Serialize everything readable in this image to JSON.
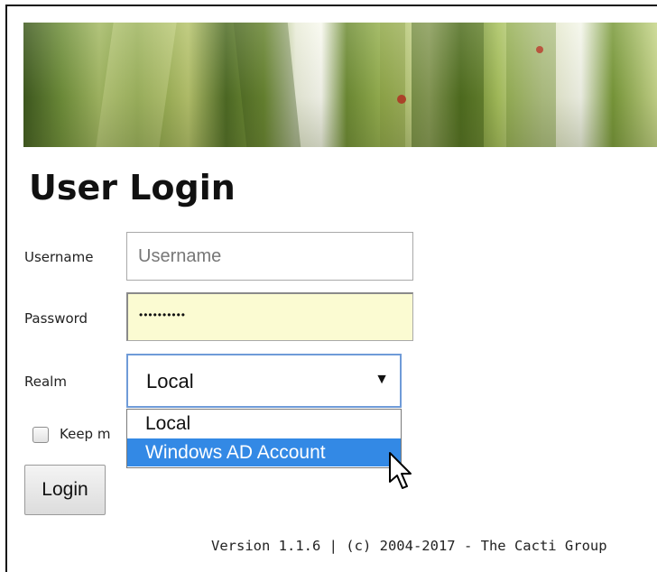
{
  "header": {
    "title": "User Login"
  },
  "form": {
    "username_label": "Username",
    "username_placeholder": "Username",
    "password_label": "Password",
    "password_value": "••••••••••",
    "realm_label": "Realm",
    "realm_selected": "Local",
    "realm_options": [
      "Local",
      "Windows AD Account"
    ],
    "realm_highlighted": "Windows AD Account",
    "keep_label": "Keep m",
    "keep_checked": false,
    "login_label": "Login"
  },
  "footer": {
    "version": "Version 1.1.6 | (c) 2004-2017 - The Cacti Group"
  },
  "colors": {
    "highlight": "#3389e5",
    "password_bg": "#fbfbd2",
    "focus_border": "#6f9bd8"
  },
  "icons": {
    "select_arrow": "triangle-down-icon",
    "cursor": "mouse-pointer-icon"
  }
}
